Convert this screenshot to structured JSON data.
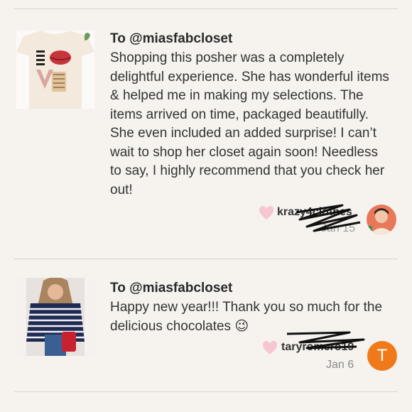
{
  "reviews": [
    {
      "to": "To @miasfabcloset",
      "text": "Shopping this posher was a completely delightful experience. She has wonderful items & helped me in making my selections. The items arrived on time, packaged beautifully. She even included an added surprise! I can’t wait to shop her closet again soon! Needless to say, I highly recommend that you check her out!",
      "username": "krazy4clothes",
      "date": "Jan 15",
      "thumb_icon": "tshirt-lips-icon",
      "avatar_icon": "user-photo-avatar"
    },
    {
      "to": "To @miasfabcloset",
      "text": "Happy new year!!! Thank you so much for the delicious chocolates 😉",
      "username": "taryromero19",
      "date": "Jan 6",
      "thumb_icon": "striped-sweater-photo-icon",
      "avatar_letter": "T"
    }
  ],
  "colors": {
    "background": "#f6f3ee",
    "heart": "#f7c7d1",
    "avatar_orange": "#f07a1a"
  }
}
